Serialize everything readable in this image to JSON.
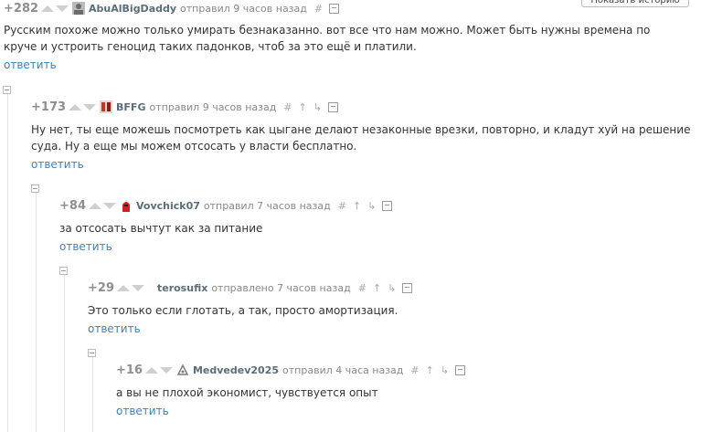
{
  "top_button": "Показать историю",
  "comments": [
    {
      "score": "+282",
      "author": "AbuAlBigDaddy",
      "meta": "отправил 9 часов назад",
      "hash": "#",
      "text": "Русским похоже можно только умирать безнаказанно. вот все что нам можно. Может быть нужны времена по круче и устроить геноцид таких падонков, чтоб за это ещё и платили.",
      "reply": "ответить",
      "avatar_color": "#6b6b6b"
    },
    {
      "score": "+173",
      "author": "BFFG",
      "meta": "отправил 9 часов назад",
      "hash": "#",
      "up_icon": "ↀ",
      "down_icon": "ↀ",
      "text": "Ну нет, ты еще можешь посмотреть как цыгане делают незаконные врезки, повторно, и кладут хуй на решение суда. Ну а еще мы можем отсосать у власти бесплатно.",
      "reply": "ответить",
      "avatar_color": "#c0392b"
    },
    {
      "score": "+84",
      "author": "Vovchick07",
      "meta": "отправил 7 часов назад",
      "hash": "#",
      "text": "за отсосать вычтут как за питание",
      "reply": "ответить",
      "avatar_color": "#d21f1f"
    },
    {
      "score": "+29",
      "author": "terosufix",
      "meta": "отправлено 7 часов назад",
      "hash": "#",
      "text": "Это только если глотать, а так, просто амортизация.",
      "reply": "ответить",
      "avatar_color": ""
    },
    {
      "score": "+16",
      "author": "Medvedev2025",
      "meta": "отправил 4 часа назад",
      "hash": "#",
      "text": "а вы не плохой экономист, чувствуется опыт",
      "reply": "ответить",
      "avatar_color": "#7a7a7a"
    }
  ],
  "icons": {
    "parent": "parent-link-icon",
    "branch": "branch-icon",
    "save": "save-icon"
  }
}
